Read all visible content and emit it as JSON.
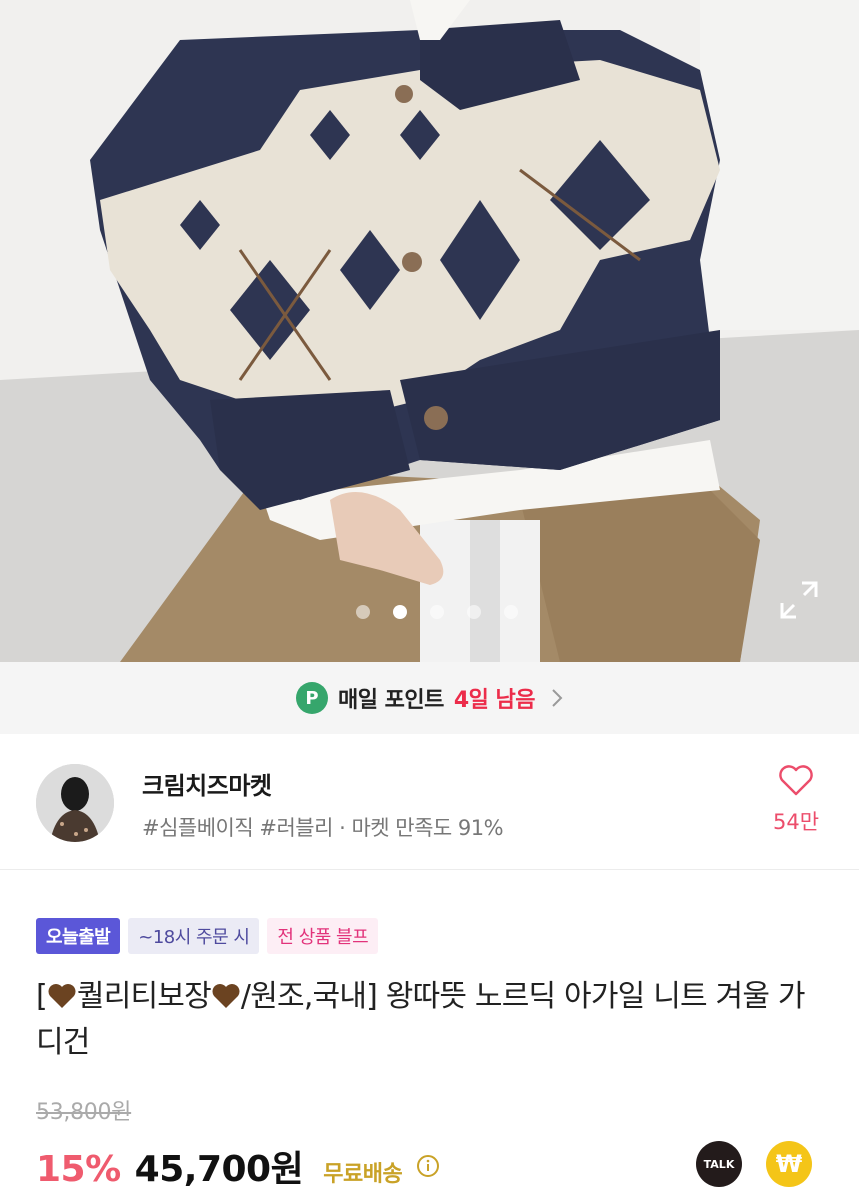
{
  "gallery": {
    "slide_count": 5,
    "active_index": 1,
    "expand_icon": "expand-icon"
  },
  "point_banner": {
    "icon_letter": "P",
    "label": "매일 포인트",
    "days_left": "4일 남음",
    "chevron_icon": "chevron-right-icon",
    "colors": {
      "icon": "#36a66c",
      "days": "#ec2c4a"
    }
  },
  "shop": {
    "name": "크림치즈마켓",
    "tags": "#심플베이직 #러블리 · 마켓 만족도 91%",
    "like_icon": "heart-outline-icon",
    "like_count": "54만",
    "like_color": "#ec4d6b"
  },
  "product": {
    "badges": {
      "today": "오늘출발",
      "cutoff": "~18시 주문 시",
      "sale": "전 상품 블프"
    },
    "title_prefix": "[",
    "title_part1": "퀄리티보장",
    "title_part2": "/원조,국내] 왕따뜻 노르딕 아가일 니트 겨울 가디건",
    "heart_emoji": "brown-heart-icon",
    "original_price": "53,800원",
    "discount": "15%",
    "price": "45,700원",
    "shipping": "무료배송",
    "talk_label": "TALK",
    "pay_symbol": "₩",
    "colors": {
      "discount": "#ef5b6e",
      "shipping": "#c9a227",
      "today_badge": "#5b57d8",
      "sale_badge_text": "#e2337b"
    }
  }
}
